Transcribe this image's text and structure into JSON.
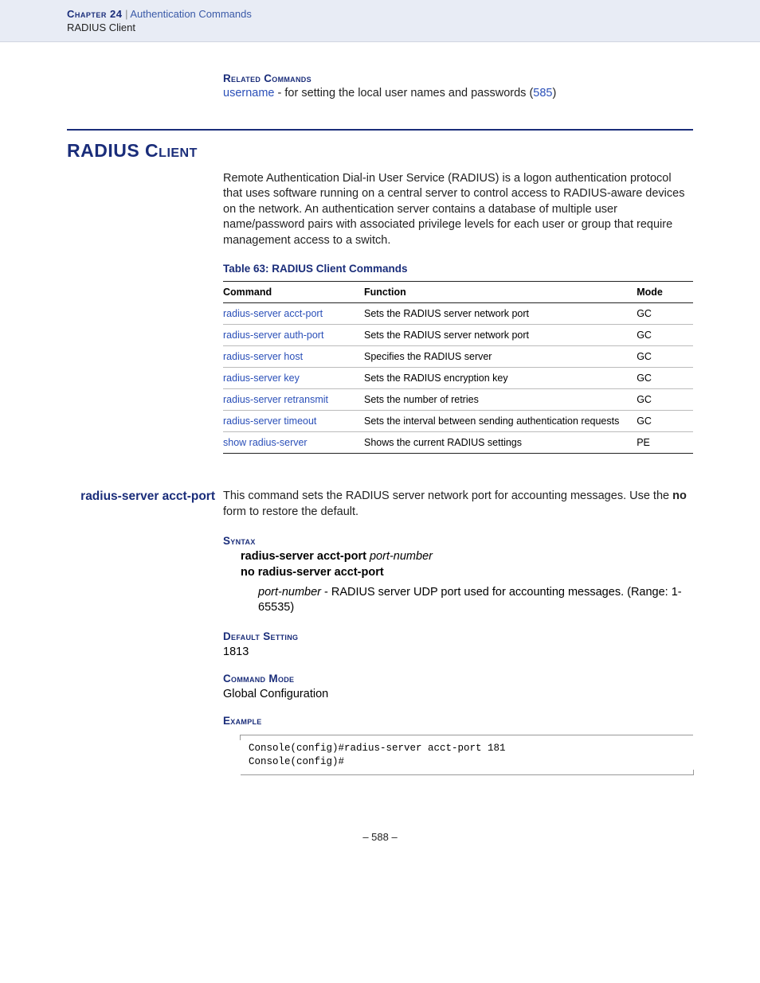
{
  "header": {
    "chapter_label": "Chapter 24",
    "separator": "|",
    "chapter_title": "Authentication Commands",
    "section": "RADIUS Client"
  },
  "related": {
    "heading": "Related Commands",
    "link": "username",
    "text_mid": " - for setting the local user names and passwords (",
    "page_ref": "585",
    "text_end": ")"
  },
  "section": {
    "title": "RADIUS Client",
    "intro": "Remote Authentication Dial-in User Service (RADIUS) is a logon authentication protocol that uses software running on a central server to control access to RADIUS-aware devices on the network. An authentication server contains a database of multiple user name/password pairs with associated privilege levels for each user or group that require management access to a switch."
  },
  "table": {
    "caption": "Table 63: RADIUS Client Commands",
    "headers": {
      "command": "Command",
      "function": "Function",
      "mode": "Mode"
    },
    "rows": [
      {
        "command": "radius-server acct-port",
        "function": "Sets the RADIUS server network port",
        "mode": "GC"
      },
      {
        "command": "radius-server auth-port",
        "function": "Sets the RADIUS server network port",
        "mode": "GC"
      },
      {
        "command": "radius-server host",
        "function": "Specifies the RADIUS server",
        "mode": "GC"
      },
      {
        "command": "radius-server key",
        "function": "Sets the RADIUS encryption key",
        "mode": "GC"
      },
      {
        "command": "radius-server retransmit",
        "function": "Sets the number of retries",
        "mode": "GC"
      },
      {
        "command": "radius-server timeout",
        "function": "Sets the interval between sending authentication requests",
        "mode": "GC"
      },
      {
        "command": "show radius-server",
        "function": "Shows the current RADIUS settings",
        "mode": "PE"
      }
    ]
  },
  "cmd_detail": {
    "label": "radius-server acct-port",
    "description_prefix": "This command sets the RADIUS server network port for accounting messages. Use the ",
    "description_bold": "no",
    "description_suffix": " form to restore the default.",
    "syntax": {
      "heading": "Syntax",
      "line1_cmd": "radius-server acct-port",
      "line1_arg": "port-number",
      "line2_cmd": "no radius-server acct-port",
      "param_arg": "port-number",
      "param_text": " - RADIUS server UDP port used for accounting messages. (Range: 1-65535)"
    },
    "default": {
      "heading": "Default Setting",
      "value": "1813"
    },
    "mode": {
      "heading": "Command Mode",
      "value": "Global Configuration"
    },
    "example": {
      "heading": "Example",
      "code": "Console(config)#radius-server acct-port 181\nConsole(config)#"
    }
  },
  "page_number": "–  588  –"
}
